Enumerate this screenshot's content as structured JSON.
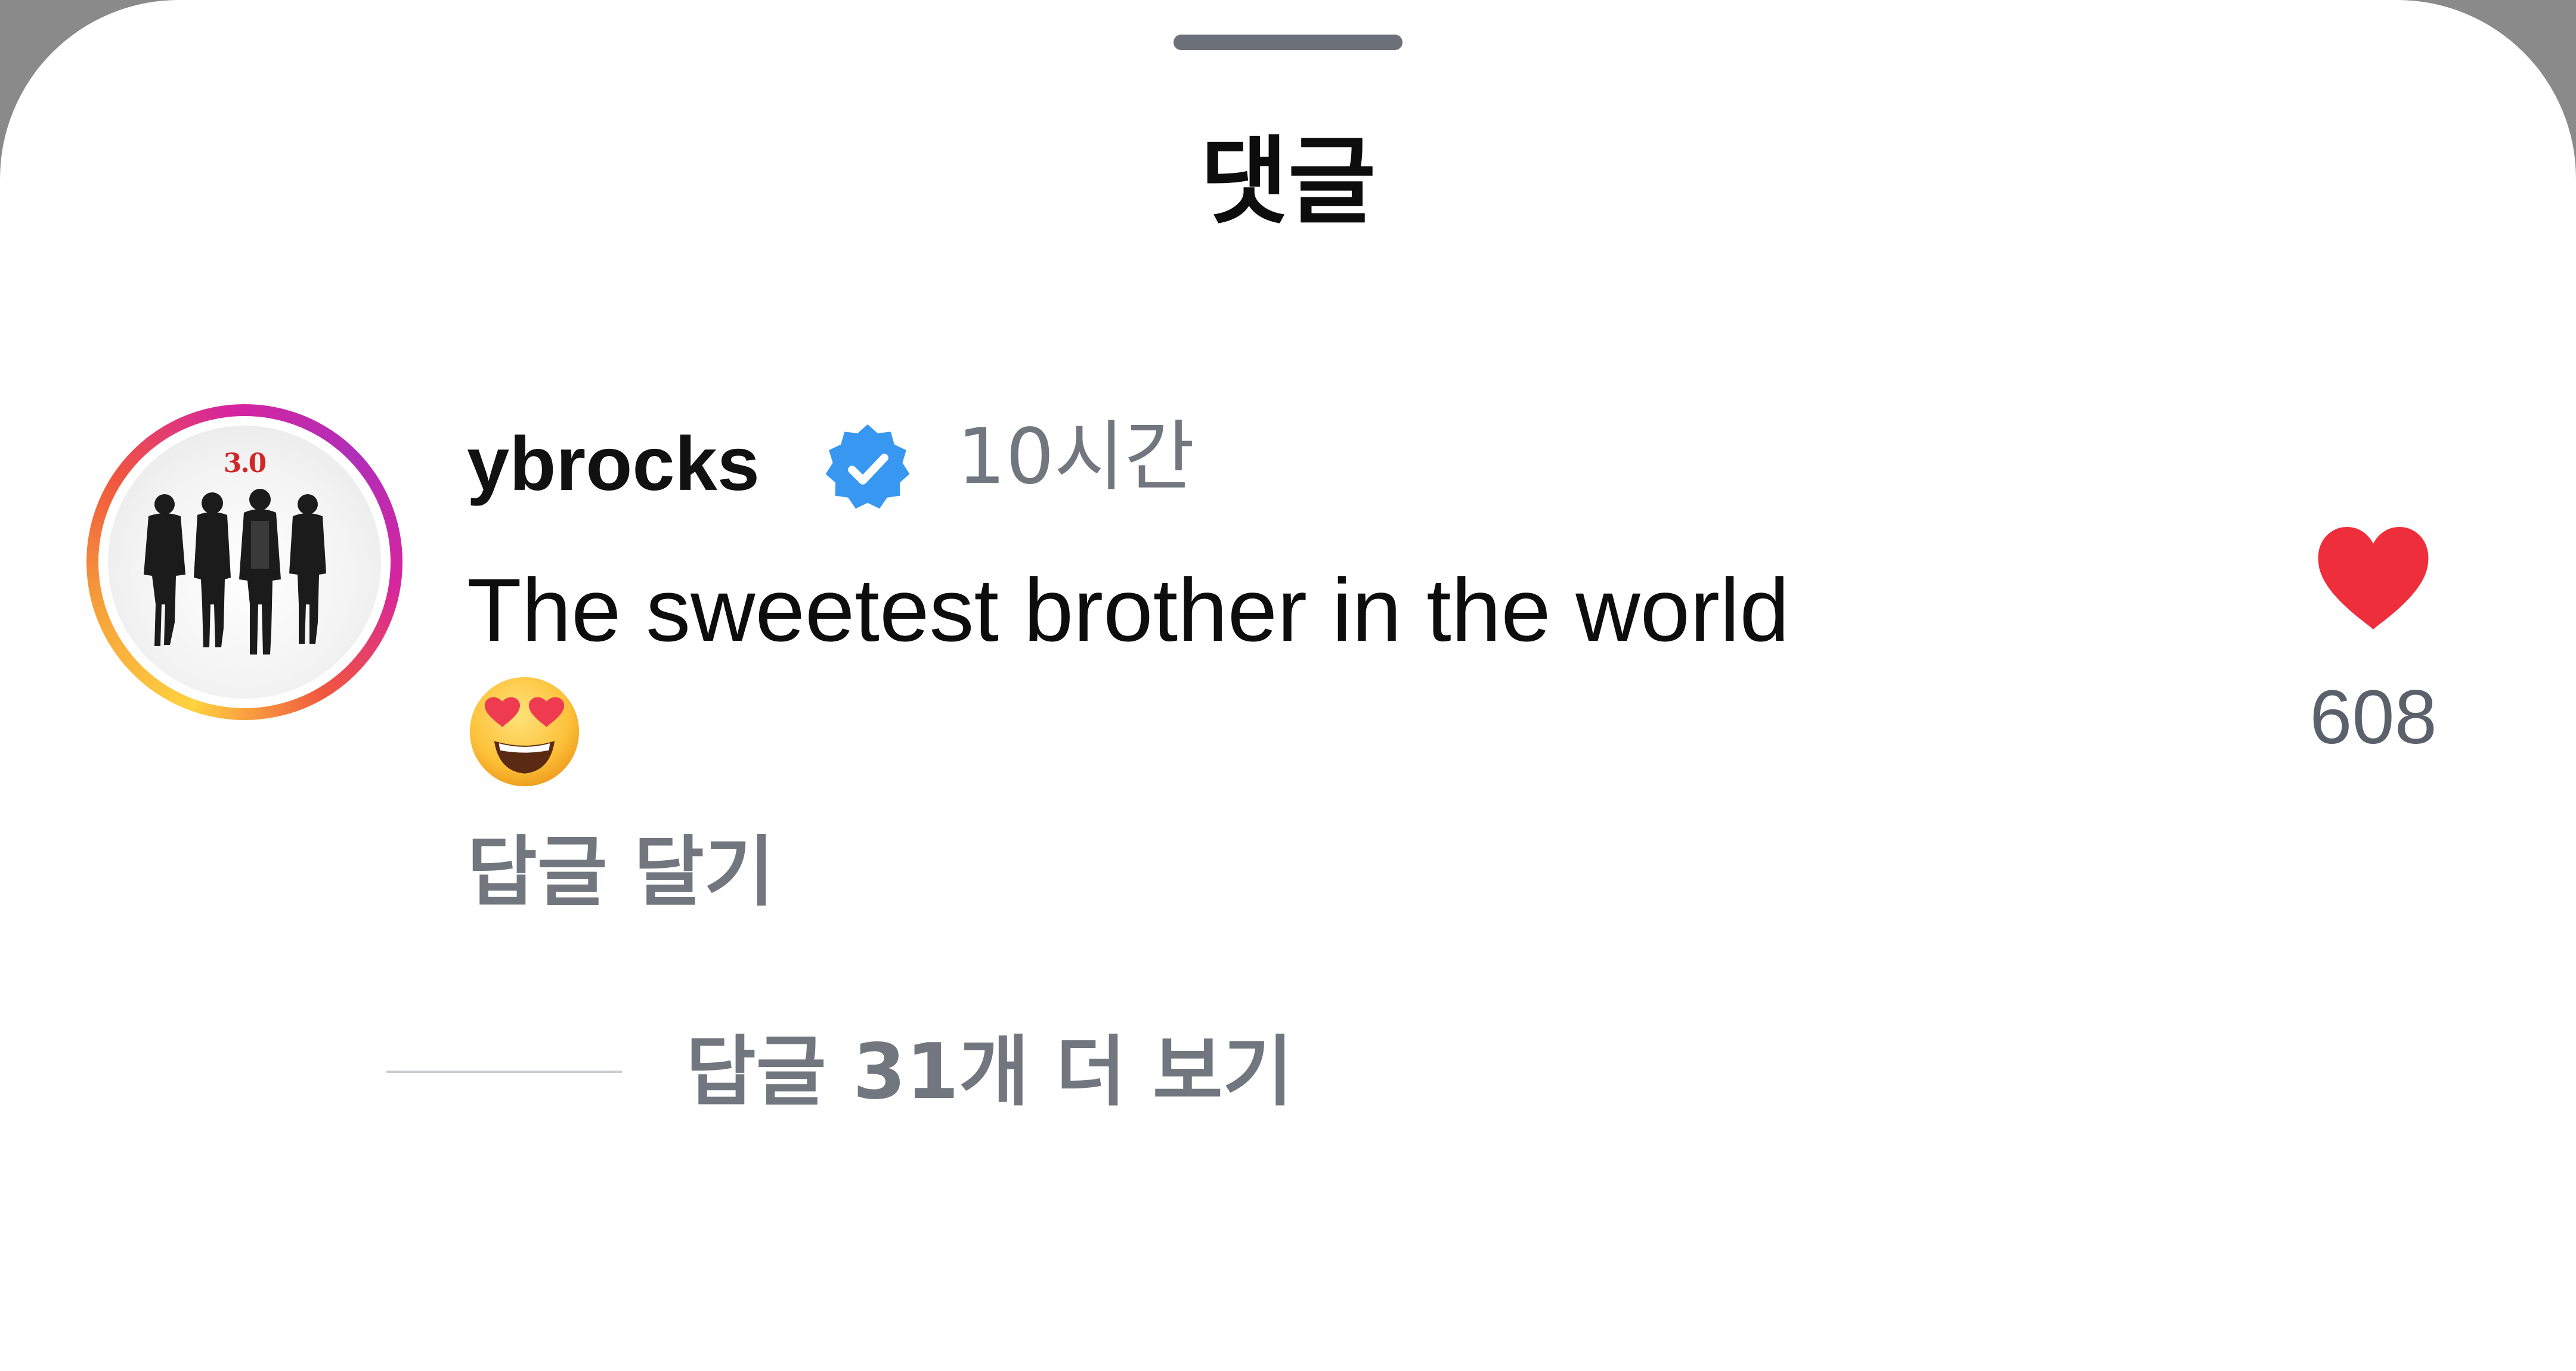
{
  "sheet": {
    "title": "댓글"
  },
  "comment": {
    "username": "ybrocks",
    "verified": true,
    "avatar_label": "3.0",
    "timestamp": "10시간",
    "text": "The sweetest brother in the world",
    "emoji": "heart-eyes-emoji",
    "reply_label": "답글 달기",
    "likes": "608",
    "liked": true,
    "more_replies_label": "답글 31개 더 보기"
  },
  "icons": {
    "verified": "verified-badge-icon",
    "like": "heart-icon"
  },
  "colors": {
    "verified": "#3897f0",
    "heart": "#ee2f3b",
    "secondary_text": "#71767f"
  }
}
